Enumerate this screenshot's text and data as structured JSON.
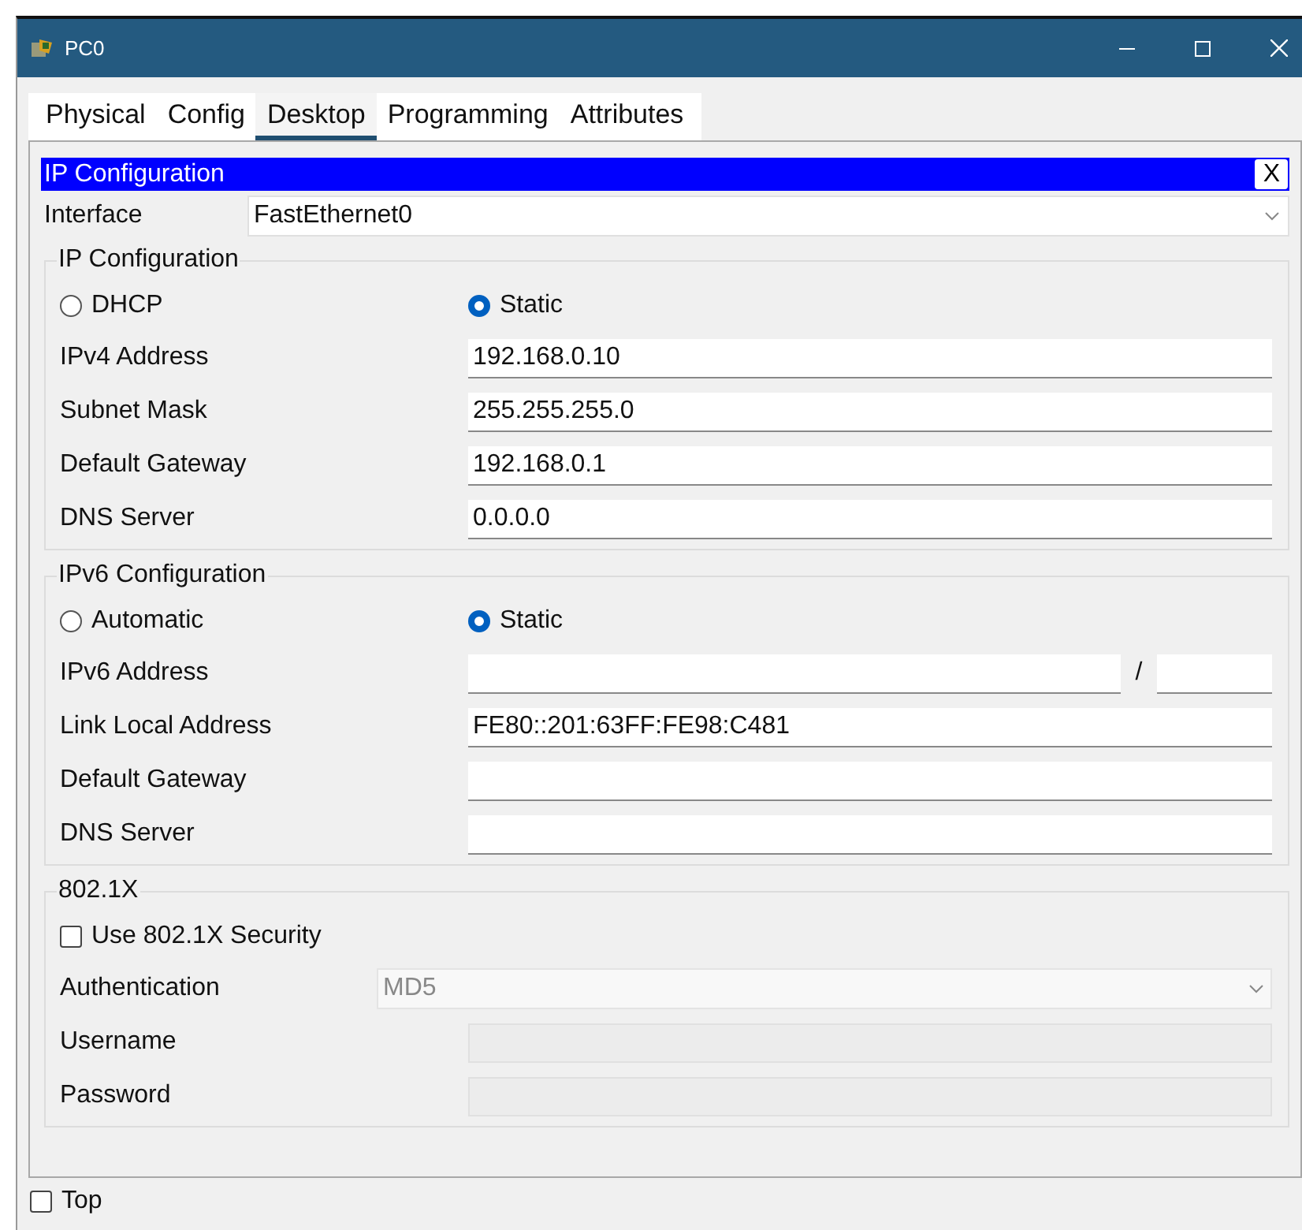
{
  "window": {
    "title": "PC0"
  },
  "tabs": [
    {
      "label": "Physical",
      "selected": false
    },
    {
      "label": "Config",
      "selected": false
    },
    {
      "label": "Desktop",
      "selected": true
    },
    {
      "label": "Programming",
      "selected": false
    },
    {
      "label": "Attributes",
      "selected": false
    }
  ],
  "dialog": {
    "title": "IP Configuration",
    "close": "X",
    "interface_label": "Interface",
    "interface_value": "FastEthernet0"
  },
  "sections": [
    {
      "title": "IP Configuration",
      "rows": [
        {
          "kind": "radio",
          "options": [
            {
              "label": "DHCP",
              "selected": false
            },
            {
              "label": "Static",
              "selected": true
            }
          ]
        },
        {
          "kind": "field",
          "label": "IPv4 Address",
          "value": "192.168.0.10",
          "disabled": false
        },
        {
          "kind": "field",
          "label": "Subnet Mask",
          "value": "255.255.255.0",
          "disabled": false
        },
        {
          "kind": "field",
          "label": "Default Gateway",
          "value": "192.168.0.1",
          "disabled": false
        },
        {
          "kind": "field",
          "label": "DNS Server",
          "value": "0.0.0.0",
          "disabled": false
        }
      ]
    },
    {
      "title": "IPv6 Configuration",
      "rows": [
        {
          "kind": "radio",
          "options": [
            {
              "label": "Automatic",
              "selected": false
            },
            {
              "label": "Static",
              "selected": true
            }
          ]
        },
        {
          "kind": "prefix",
          "label": "IPv6 Address",
          "separator": "/"
        },
        {
          "kind": "field",
          "label": "Link Local Address",
          "value": "FE80::201:63FF:FE98:C481",
          "disabled": false
        },
        {
          "kind": "field",
          "label": "Default Gateway",
          "disabled": false
        },
        {
          "kind": "field",
          "label": "DNS Server",
          "disabled": false
        }
      ]
    },
    {
      "title": "802.1X",
      "rows": [
        {
          "kind": "checkbox",
          "label": "Use 802.1X Security",
          "checked": false
        },
        {
          "kind": "select",
          "label": "Authentication",
          "value": "MD5",
          "disabled": true
        },
        {
          "kind": "field",
          "label": "Username",
          "disabled": true
        },
        {
          "kind": "field",
          "label": "Password",
          "disabled": true
        }
      ]
    }
  ],
  "footer": {
    "label": "Top",
    "checked": false
  }
}
